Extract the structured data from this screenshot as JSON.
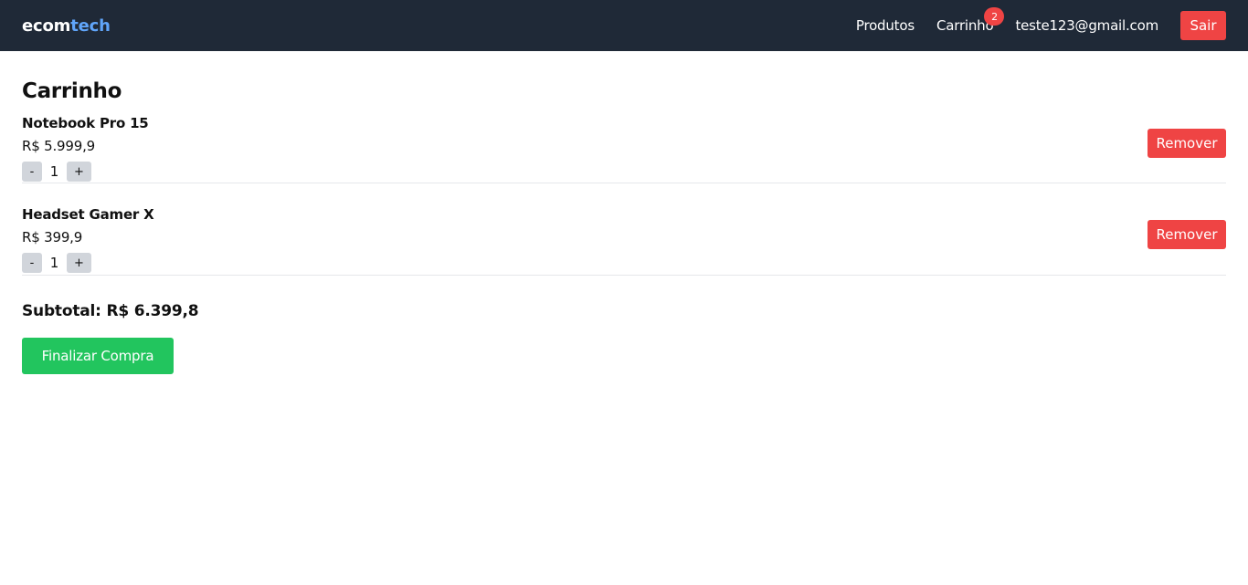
{
  "header": {
    "logo_part1": "ecom",
    "logo_part2": "tech",
    "nav": {
      "products": "Produtos",
      "cart": "Carrinho",
      "cart_count": "2"
    },
    "user_email": "teste123@gmail.com",
    "logout_label": "Sair"
  },
  "main": {
    "title": "Carrinho",
    "items": [
      {
        "name": "Notebook Pro 15",
        "price": "R$ 5.999,9",
        "quantity": "1",
        "decrease_label": "-",
        "increase_label": "+",
        "remove_label": "Remover"
      },
      {
        "name": "Headset Gamer X",
        "price": "R$ 399,9",
        "quantity": "1",
        "decrease_label": "-",
        "increase_label": "+",
        "remove_label": "Remover"
      }
    ],
    "subtotal": "Subtotal: R$ 6.399,8",
    "checkout_label": "Finalizar Compra"
  },
  "colors": {
    "header_bg": "#1f2937",
    "logo_accent": "#60a5fa",
    "danger": "#ef4444",
    "success": "#22c55e",
    "qty_button": "#d1d5db"
  }
}
